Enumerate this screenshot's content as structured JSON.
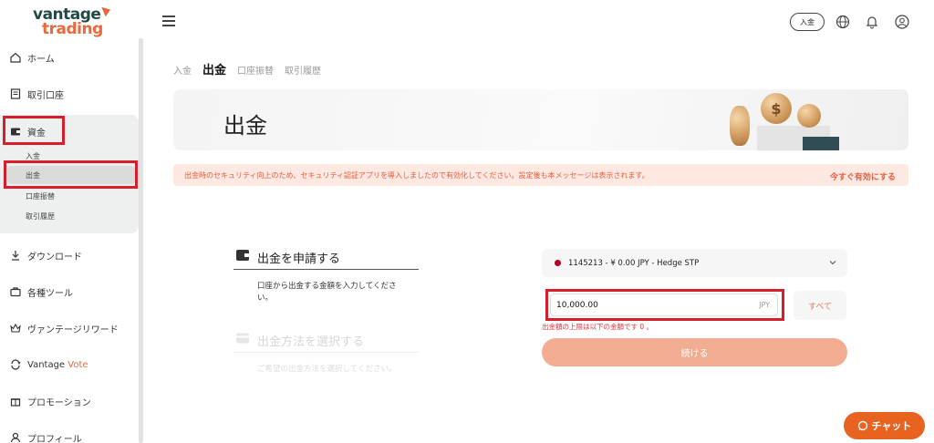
{
  "brand": {
    "line1": "vantage",
    "line2": "trading",
    "accent": "#e86a3a",
    "dark": "#1f4a45"
  },
  "sidebar": {
    "items": [
      {
        "label": "ホーム",
        "icon": "home-icon"
      },
      {
        "label": "取引口座",
        "icon": "document-icon"
      },
      {
        "label": "資金",
        "icon": "wallet-icon"
      },
      {
        "label": "ダウンロード",
        "icon": "download-icon"
      },
      {
        "label": "各種ツール",
        "icon": "briefcase-icon"
      },
      {
        "label": "ヴァンテージリワード",
        "icon": "crown-icon"
      },
      {
        "label": "Vantage",
        "label_accent": "Vote",
        "icon": "vote-icon"
      },
      {
        "label": "プロモーション",
        "icon": "gift-icon"
      },
      {
        "label": "プロフィール",
        "icon": "user-icon"
      }
    ],
    "fund_sub": [
      "入金",
      "出金",
      "口座振替",
      "取引履歴"
    ]
  },
  "header": {
    "deposit_label": "入金",
    "icons": [
      "globe-icon",
      "bell-icon",
      "user-circle-icon"
    ]
  },
  "tabs": [
    "入金",
    "出金",
    "口座振替",
    "取引履歴"
  ],
  "banner": {
    "title": "出金"
  },
  "notice": {
    "text": "出金時のセキュリティ向上のため、セキュリティ認証アプリを導入しましたので有効化してください。設定後も本メッセージは表示されます。",
    "link": "今すぐ有効にする"
  },
  "steps": [
    {
      "title": "出金を申請する",
      "desc_line1": "口座から出金する金額を入力してくださ",
      "desc_line2": "い。"
    },
    {
      "title": "出金方法を選択する",
      "desc": "ご希望の出金方法を選択してください。"
    }
  ],
  "form": {
    "account": "1145213 - ¥ 0.00 JPY - Hedge STP",
    "amount": "10,000.00",
    "currency": "JPY",
    "all_label": "すべて",
    "error": "出金額の上限は以下の金額です 0 。",
    "continue_label": "続ける"
  },
  "chat": {
    "label": "チャット"
  },
  "colors": {
    "highlight": "#d81e2a",
    "button": "#f2ac92",
    "chat": "#e8631f"
  }
}
